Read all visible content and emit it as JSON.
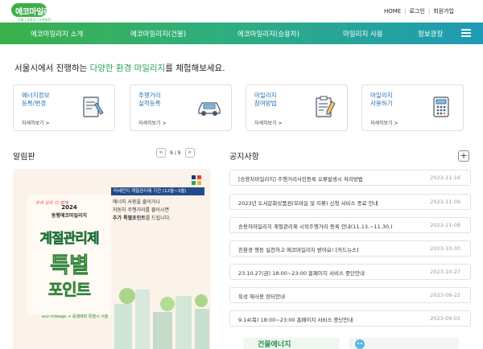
{
  "brand": {
    "logo_text": "에코마일리지",
    "logo_sub": "건물 | 승용차 | 녹색실천",
    "green": "#3fae49",
    "blue": "#1f9bb4"
  },
  "util_links": [
    "HOME",
    "로그인",
    "회원가입"
  ],
  "nav": {
    "items": [
      "에코마일리지 소개",
      "에코마일리지(건물)",
      "에코마일리지(승용차)",
      "마일리지 사용",
      "정보광장"
    ],
    "menu_icon": "hamburger-icon"
  },
  "intro": {
    "prefix": "서울시에서 진행하는",
    "highlight": "다양한 환경 마일리지",
    "suffix": "를 체험해보세요."
  },
  "cards": [
    {
      "title": "에너지정보\n등록/변경",
      "more": "자세히보기 >",
      "icon": "document-pen-icon"
    },
    {
      "title": "주행거리\n실적등록",
      "more": "자세히보기 >",
      "icon": "car-icon"
    },
    {
      "title": "마일리지\n참여방법",
      "more": "자세히보기 >",
      "icon": "clipboard-pen-icon"
    },
    {
      "title": "마일리지\n사용하기",
      "more": "자세히보기 >",
      "icon": "calculator-icon"
    }
  ],
  "alerts": {
    "title": "알림판",
    "page_current": "9",
    "page_total": "9",
    "prev_icon": "chevron-left-icon",
    "next_icon": "chevron-right-icon"
  },
  "banner": {
    "tag": "우리 모두 다 함께",
    "year": "2024",
    "sub": "동행에코마일리지",
    "big1": "계절관리제",
    "big2": "특별",
    "big3": "포인트",
    "head": "미세먼지 계절관리제 기간 (12월~3월)",
    "line1": "에너지 사용을 줄이거나",
    "line2": "자동차 주행거리를 줄이시면",
    "line3_strong": "추가 특별포인트",
    "line3_rest": "를 드립니다.",
    "logos": "eco mileage + 동행매력 특별시 서울"
  },
  "notices": {
    "title": "공지사항",
    "add_icon": "plus-icon",
    "items": [
      {
        "title": "[승용차마일리지] 주행거리사진등록 오류발생시 처리방법",
        "date": "2023-11-16"
      },
      {
        "title": "2023년 도서문화상품권(모바일 및 지류) 신청 서비스 종료 안내",
        "date": "2023-11-09"
      },
      {
        "title": "승용차마일리지 계절관리제 시작주행거리 등록 안내(11.13.~11.30.)",
        "date": "2023-11-08"
      },
      {
        "title": "친환경 행동 실천하고 에코마일리지 받아요! [카드뉴스]",
        "date": "2023-10-30"
      },
      {
        "title": "23.10.27(금) 18:00~23:00 홈페이지 서비스 중단안내",
        "date": "2023-10-27"
      },
      {
        "title": "육성 재사용 장터안내",
        "date": "2023-09-22"
      },
      {
        "title": "9.14(목) 18:00~23:00 홈페이지 서비스 중단안내",
        "date": "2023-09-01"
      }
    ]
  },
  "bottom_banner": {
    "text": "건물에너지"
  }
}
